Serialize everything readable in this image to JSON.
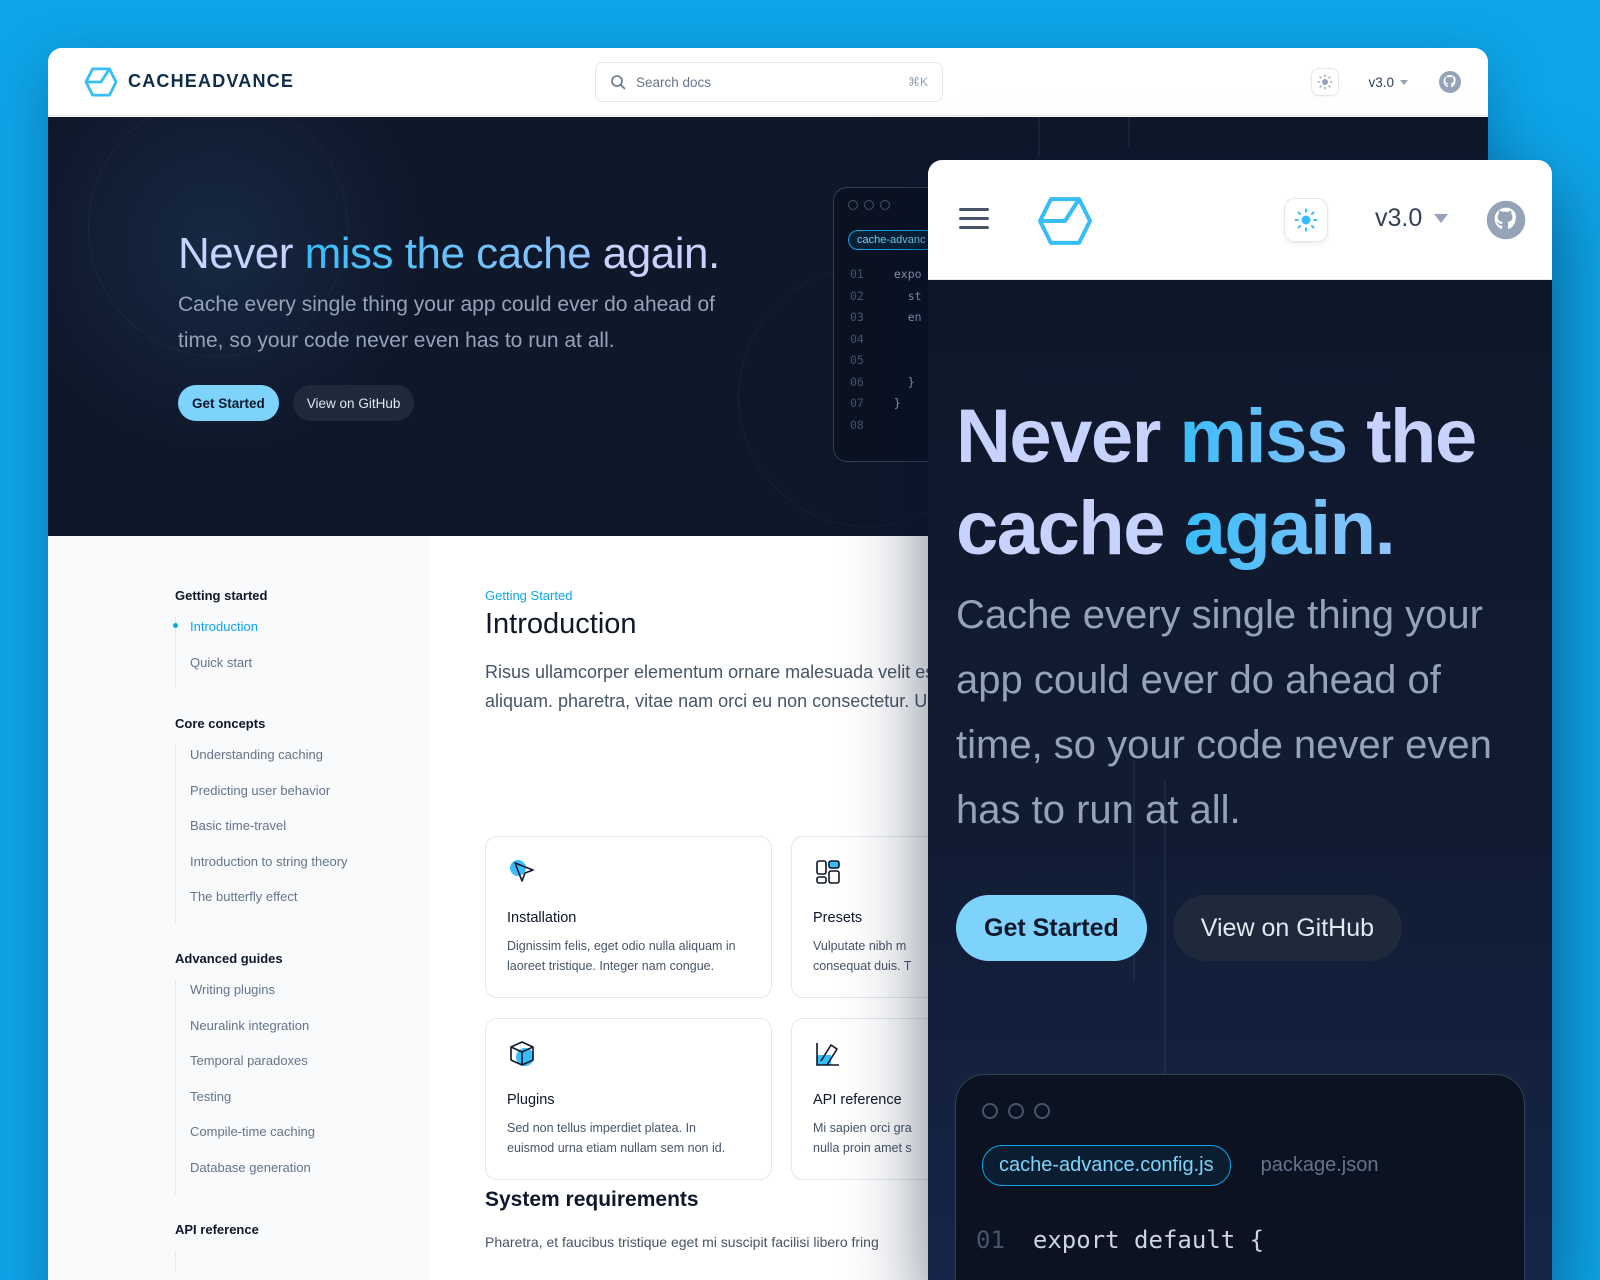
{
  "brand": {
    "name": "CACHEADVANCE"
  },
  "search": {
    "placeholder": "Search docs",
    "shortcut": "⌘K"
  },
  "header": {
    "version": "v3.0"
  },
  "hero": {
    "title_a": "Never ",
    "title_b": "miss the cache",
    "title_c": " again.",
    "subtitle": "Cache every single thing your app could ever do ahead of time, so your code never even has to run at all.",
    "primary_btn": "Get Started",
    "secondary_btn": "View on GitHub"
  },
  "code_preview": {
    "tab_active": "cache-advance.config.js",
    "tab_active_short": "cache-advanc",
    "tab_other": "package.json",
    "line_numbers": [
      "01",
      "02",
      "03",
      "04",
      "05",
      "06",
      "07",
      "08"
    ],
    "lines": [
      "expo",
      "  st",
      "  en",
      "    ",
      "    ",
      "  }",
      "}",
      ""
    ],
    "first_line": "export default {"
  },
  "sidebar": {
    "sections": [
      {
        "title": "Getting started",
        "items": [
          "Introduction",
          "Quick start"
        ]
      },
      {
        "title": "Core concepts",
        "items": [
          "Understanding caching",
          "Predicting user behavior",
          "Basic time-travel",
          "Introduction to string theory",
          "The butterfly effect"
        ]
      },
      {
        "title": "Advanced guides",
        "items": [
          "Writing plugins",
          "Neuralink integration",
          "Temporal paradoxes",
          "Testing",
          "Compile-time caching",
          "Database generation"
        ]
      },
      {
        "title": "API reference",
        "items": []
      }
    ],
    "active_item": "Introduction"
  },
  "content": {
    "eyebrow": "Getting Started",
    "title": "Introduction",
    "lead": "Risus ullamcorper elementum ornare malesuada velit est. Sapien ut viverra lectus imperdiet urna aliquam. pharetra, vitae nam orci eu non consectetur. Ultrices",
    "cards": [
      {
        "icon": "cursor-arrow-icon",
        "title": "Installation",
        "desc1": "Dignissim felis, eget odio nulla aliquam in",
        "desc2": "laoreet tristique. Integer nam congue."
      },
      {
        "icon": "layout-presets-icon",
        "title": "Presets",
        "desc1": "Vulputate nibh m",
        "desc2": "consequat duis. T"
      },
      {
        "icon": "package-box-icon",
        "title": "Plugins",
        "desc1": "Sed non tellus imperdiet platea. In",
        "desc2": "euismod urna etiam nullam sem non id."
      },
      {
        "icon": "api-reference-icon",
        "title": "API reference",
        "desc1": "Mi sapien orci gra",
        "desc2": "nulla proin amet s"
      }
    ],
    "section2_title": "System requirements",
    "section2_text": "Pharetra, et faucibus tristique eget mi suscipit facilisi libero fring"
  },
  "mobile": {
    "title_l1a": "Never ",
    "title_l1b": "miss ",
    "title_l1c": "the",
    "title_l2a": "cache ",
    "title_l2b": "again.",
    "subtitle": "Cache every single thing your app could ever do ahead of time, so your code never even has to run at all."
  },
  "colors": {
    "accent": "#0ea5e9",
    "hero_bg": "#0f172a",
    "page_bg": "#0ea5e9",
    "button": "#7dd3fc"
  }
}
